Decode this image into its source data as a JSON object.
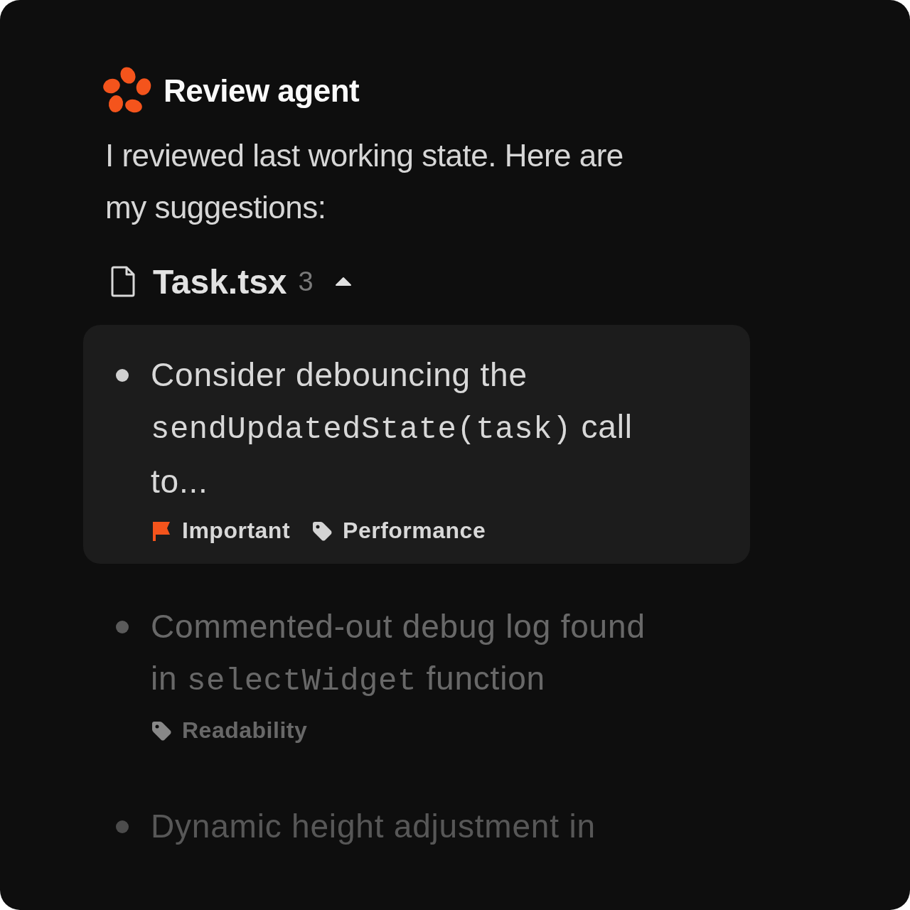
{
  "agent": {
    "name": "Review agent"
  },
  "message": "I reviewed last working state. Here are my suggestions:",
  "file": {
    "name": "Task.tsx",
    "count": "3",
    "expanded": true
  },
  "suggestions": [
    {
      "selected": true,
      "lines": [
        [
          {
            "code": false,
            "text": "Consider debouncing the"
          }
        ],
        [
          {
            "code": true,
            "text": "sendUpdatedState(task)"
          },
          {
            "code": false,
            "text": " call"
          }
        ],
        [
          {
            "code": false,
            "text": "to..."
          }
        ]
      ],
      "tags": [
        {
          "kind": "flag",
          "label": "Important"
        },
        {
          "kind": "tag",
          "label": "Performance"
        }
      ]
    },
    {
      "selected": false,
      "lines": [
        [
          {
            "code": false,
            "text": "Commented-out debug log found"
          }
        ],
        [
          {
            "code": false,
            "text": "in "
          },
          {
            "code": true,
            "text": "selectWidget"
          },
          {
            "code": false,
            "text": " function"
          }
        ]
      ],
      "tags": [
        {
          "kind": "tag",
          "label": "Readability"
        }
      ]
    },
    {
      "selected": false,
      "lines": [
        [
          {
            "code": false,
            "text": "Dynamic height adjustment in"
          }
        ]
      ]
    }
  ]
}
